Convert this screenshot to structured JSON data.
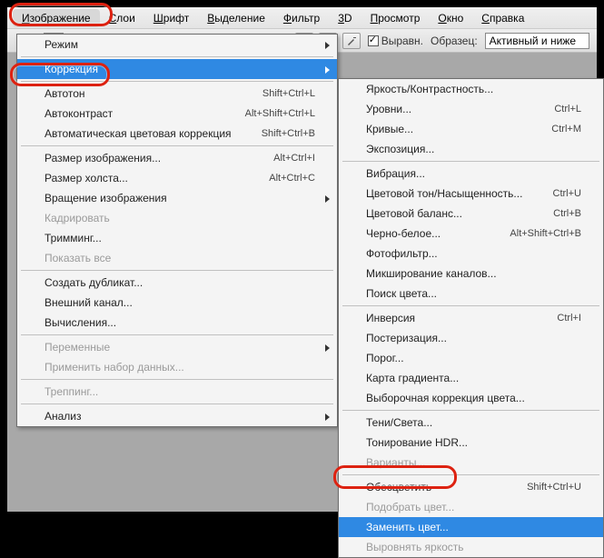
{
  "menubar": {
    "items": [
      {
        "label": "Изображение",
        "open": true
      },
      {
        "label": "Слои"
      },
      {
        "label": "Шрифт"
      },
      {
        "label": "Выделение"
      },
      {
        "label": "Фильтр"
      },
      {
        "label": "3D"
      },
      {
        "label": "Просмотр"
      },
      {
        "label": "Окно"
      },
      {
        "label": "Справка"
      }
    ]
  },
  "toolbar": {
    "align_label": "Выравн.",
    "sample_label": "Образец:",
    "sample_value": "Активный и ниже"
  },
  "menu_left": [
    {
      "label": "Режим",
      "type": "sub"
    },
    {
      "type": "sep"
    },
    {
      "label": "Коррекция",
      "type": "sub",
      "hl": true
    },
    {
      "type": "sep"
    },
    {
      "label": "Автотон",
      "shortcut": "Shift+Ctrl+L"
    },
    {
      "label": "Автоконтраст",
      "shortcut": "Alt+Shift+Ctrl+L"
    },
    {
      "label": "Автоматическая цветовая коррекция",
      "shortcut": "Shift+Ctrl+B"
    },
    {
      "type": "sep"
    },
    {
      "label": "Размер изображения...",
      "shortcut": "Alt+Ctrl+I"
    },
    {
      "label": "Размер холста...",
      "shortcut": "Alt+Ctrl+C"
    },
    {
      "label": "Вращение изображения",
      "type": "sub"
    },
    {
      "label": "Кадрировать",
      "disabled": true
    },
    {
      "label": "Тримминг..."
    },
    {
      "label": "Показать все",
      "disabled": true
    },
    {
      "type": "sep"
    },
    {
      "label": "Создать дубликат..."
    },
    {
      "label": "Внешний канал..."
    },
    {
      "label": "Вычисления..."
    },
    {
      "type": "sep"
    },
    {
      "label": "Переменные",
      "type": "sub",
      "disabled": true
    },
    {
      "label": "Применить набор данных...",
      "disabled": true
    },
    {
      "type": "sep"
    },
    {
      "label": "Треппинг...",
      "disabled": true
    },
    {
      "type": "sep"
    },
    {
      "label": "Анализ",
      "type": "sub"
    }
  ],
  "menu_right": [
    {
      "label": "Яркость/Контрастность..."
    },
    {
      "label": "Уровни...",
      "shortcut": "Ctrl+L"
    },
    {
      "label": "Кривые...",
      "shortcut": "Ctrl+M"
    },
    {
      "label": "Экспозиция..."
    },
    {
      "type": "sep"
    },
    {
      "label": "Вибрация..."
    },
    {
      "label": "Цветовой тон/Насыщенность...",
      "shortcut": "Ctrl+U"
    },
    {
      "label": "Цветовой баланс...",
      "shortcut": "Ctrl+B"
    },
    {
      "label": "Черно-белое...",
      "shortcut": "Alt+Shift+Ctrl+B"
    },
    {
      "label": "Фотофильтр..."
    },
    {
      "label": "Микширование каналов..."
    },
    {
      "label": "Поиск цвета..."
    },
    {
      "type": "sep"
    },
    {
      "label": "Инверсия",
      "shortcut": "Ctrl+I"
    },
    {
      "label": "Постеризация..."
    },
    {
      "label": "Порог..."
    },
    {
      "label": "Карта градиента..."
    },
    {
      "label": "Выборочная коррекция цвета..."
    },
    {
      "type": "sep"
    },
    {
      "label": "Тени/Света..."
    },
    {
      "label": "Тонирование HDR..."
    },
    {
      "label": "Варианты...",
      "disabled": true
    },
    {
      "type": "sep"
    },
    {
      "label": "Обесцветить",
      "shortcut": "Shift+Ctrl+U"
    },
    {
      "label": "Подобрать цвет...",
      "disabled": true
    },
    {
      "label": "Заменить цвет...",
      "hl": true
    },
    {
      "label": "Выровнять яркость",
      "disabled": true
    }
  ]
}
